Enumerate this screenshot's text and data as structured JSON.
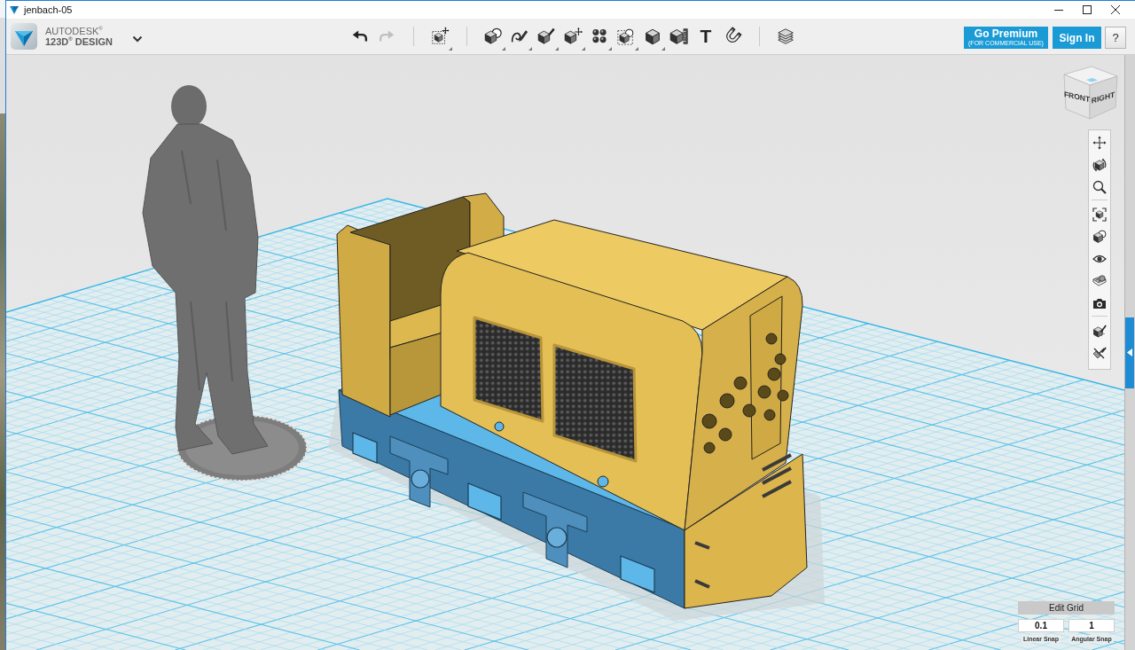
{
  "window": {
    "title": "jenbach-05"
  },
  "header": {
    "brand": "AUTODESK$^{®}$",
    "product": "123D$^{®}$ DESIGN"
  },
  "toolbar": {
    "groups": [
      [
        {
          "kind": "undo",
          "disabled": false,
          "menu": false
        },
        {
          "kind": "redo",
          "disabled": true,
          "menu": false
        }
      ],
      [
        {
          "kind": "transform",
          "disabled": false,
          "menu": true
        }
      ],
      [
        {
          "kind": "primitives",
          "disabled": false,
          "menu": true
        },
        {
          "kind": "sketch",
          "disabled": false,
          "menu": true
        },
        {
          "kind": "construct",
          "disabled": false,
          "menu": true
        },
        {
          "kind": "modify",
          "disabled": false,
          "menu": true
        },
        {
          "kind": "pattern",
          "disabled": false,
          "menu": true
        },
        {
          "kind": "grouping",
          "disabled": false,
          "menu": true
        },
        {
          "kind": "combine",
          "disabled": false,
          "menu": true
        },
        {
          "kind": "measure",
          "disabled": false,
          "menu": false
        },
        {
          "kind": "text",
          "label": "T",
          "disabled": false,
          "menu": false
        },
        {
          "kind": "snap",
          "disabled": false,
          "menu": false
        }
      ],
      [
        {
          "kind": "material",
          "disabled": false,
          "menu": false
        }
      ]
    ]
  },
  "account": {
    "premium": {
      "label": "Go Premium",
      "note": "(FOR COMMERCIAL USE)"
    },
    "sign_in": "Sign In",
    "help": "?"
  },
  "view_cube": {
    "front": "FRONT",
    "right": "RIGHT"
  },
  "grid_settings": {
    "title": "Edit Grid",
    "linear_snap": {
      "value": "0.1",
      "label": "Linear Snap"
    },
    "angular_snap": {
      "value": "1",
      "label": "Angular Snap"
    }
  }
}
